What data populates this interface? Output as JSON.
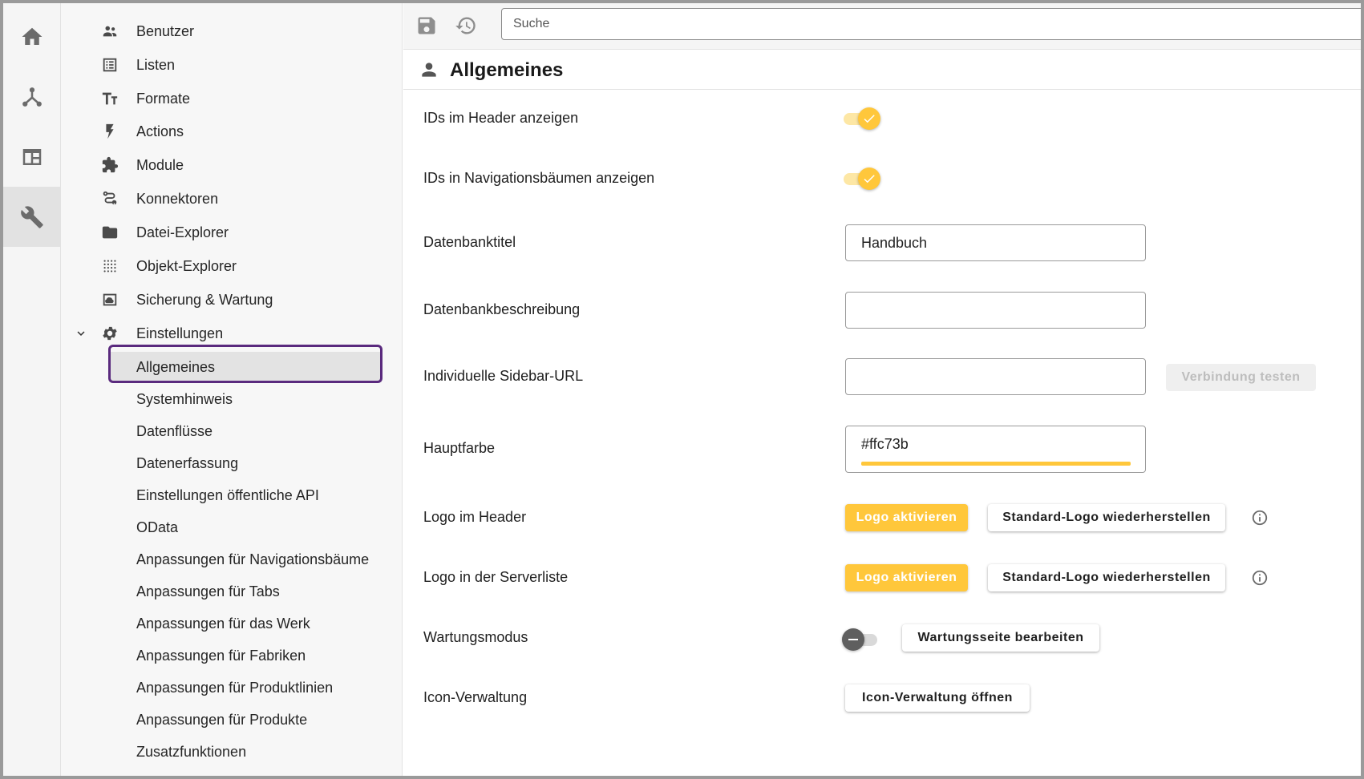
{
  "toolbar": {
    "save_icon": "save-icon",
    "history_icon": "history-icon",
    "search_placeholder": "Suche"
  },
  "sidebar": {
    "items": [
      {
        "label": "Benutzer",
        "icon": "users-icon"
      },
      {
        "label": "Listen",
        "icon": "list-icon"
      },
      {
        "label": "Formate",
        "icon": "text-format-icon"
      },
      {
        "label": "Actions",
        "icon": "lightning-icon"
      },
      {
        "label": "Module",
        "icon": "puzzle-icon"
      },
      {
        "label": "Konnektoren",
        "icon": "route-icon"
      },
      {
        "label": "Datei-Explorer",
        "icon": "folder-icon"
      },
      {
        "label": "Objekt-Explorer",
        "icon": "dots-grid-icon"
      },
      {
        "label": "Sicherung & Wartung",
        "icon": "backup-icon"
      },
      {
        "label": "Einstellungen",
        "icon": "gear-icon"
      }
    ],
    "subitems": [
      "Allgemeines",
      "Systemhinweis",
      "Datenflüsse",
      "Datenerfassung",
      "Einstellungen öffentliche API",
      "OData",
      "Anpassungen für Navigationsbäume",
      "Anpassungen für Tabs",
      "Anpassungen für das Werk",
      "Anpassungen für Fabriken",
      "Anpassungen für Produktlinien",
      "Anpassungen für Produkte",
      "Zusatzfunktionen"
    ],
    "selected": "Allgemeines"
  },
  "section": {
    "title": "Allgemeines",
    "icon": "person-icon"
  },
  "form": {
    "ids_header": {
      "label": "IDs im Header anzeigen",
      "on": true
    },
    "ids_nav": {
      "label": "IDs in Navigationsbäumen anzeigen",
      "on": true
    },
    "db_title": {
      "label": "Datenbanktitel",
      "value": "Handbuch"
    },
    "db_desc": {
      "label": "Datenbankbeschreibung",
      "value": ""
    },
    "sidebar_url": {
      "label": "Individuelle Sidebar-URL",
      "value": "",
      "test_button": "Verbindung testen"
    },
    "main_color": {
      "label": "Hauptfarbe",
      "value": "#ffc73b"
    },
    "logo_header": {
      "label": "Logo im Header",
      "activate": "Logo aktivieren",
      "restore": "Standard-Logo wiederherstellen"
    },
    "logo_serverlist": {
      "label": "Logo in der Serverliste",
      "activate": "Logo aktivieren",
      "restore": "Standard-Logo wiederherstellen"
    },
    "maintenance": {
      "label": "Wartungsmodus",
      "on": false,
      "edit": "Wartungsseite bearbeiten"
    },
    "icons": {
      "label": "Icon-Verwaltung",
      "open": "Icon-Verwaltung öffnen"
    }
  },
  "colors": {
    "accent": "#ffc73b",
    "selection_outline": "#5a2a7e"
  }
}
